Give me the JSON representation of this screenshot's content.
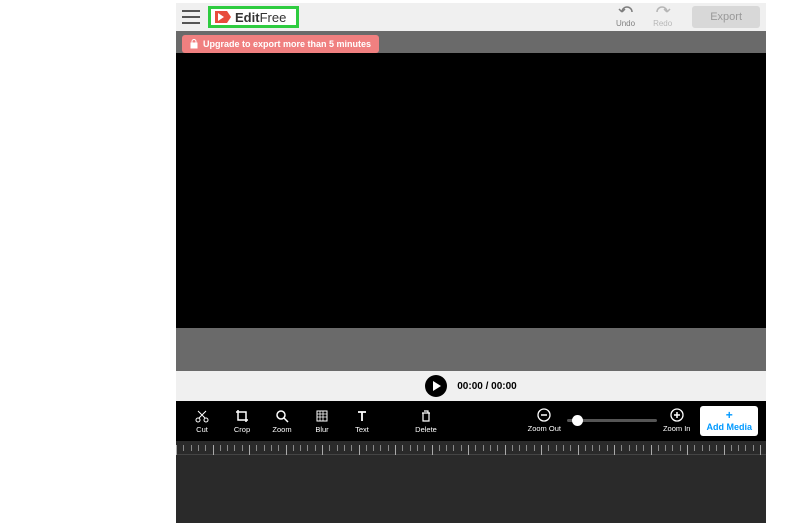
{
  "header": {
    "logo_bold": "Edit",
    "logo_light": "Free",
    "undo_label": "Undo",
    "redo_label": "Redo",
    "export_label": "Export"
  },
  "banner": {
    "upgrade_text": "Upgrade to export more than 5 minutes"
  },
  "player": {
    "time_display": "00:00 / 00:00"
  },
  "toolbar": {
    "cut": "Cut",
    "crop": "Crop",
    "zoom": "Zoom",
    "blur": "Blur",
    "text": "Text",
    "delete": "Delete",
    "zoom_out": "Zoom Out",
    "zoom_in": "Zoom In",
    "add_media": "Add Media"
  }
}
